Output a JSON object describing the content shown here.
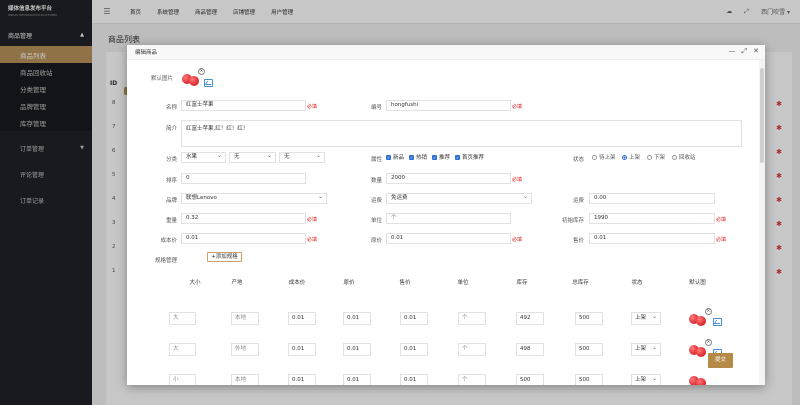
{
  "app": {
    "title": "媒体信息发布平台",
    "subtitle": "MEDIA INFORMATION PLATFORM"
  },
  "sidebar": {
    "groups": [
      {
        "label": "商品管理",
        "expanded": true,
        "items": [
          "商品列表",
          "商品回收站",
          "分类管理",
          "品牌管理",
          "库存管理"
        ],
        "active": 0
      },
      {
        "label": "订单管理",
        "expanded": false
      },
      {
        "label": "评论管理"
      },
      {
        "label": "订单记录"
      }
    ]
  },
  "topbar": {
    "nav": [
      "首页",
      "系统管理",
      "商品管理",
      "店铺管理",
      "用户管理"
    ],
    "user": "西门吹雪"
  },
  "page": {
    "title": "商品列表",
    "id_header": "ID",
    "row_ids": [
      "8",
      "7",
      "6",
      "5",
      "4",
      "3",
      "2",
      "1"
    ]
  },
  "modal": {
    "title": "编辑商品",
    "labels": {
      "default_image": "默认图片",
      "name": "名称",
      "code": "编号",
      "intro": "简介",
      "category": "分类",
      "attr": "属性",
      "status": "状态",
      "sort": "排序",
      "quantity": "数量",
      "brand": "品牌",
      "freight": "运费",
      "shipping": "运费",
      "weight": "重量",
      "unit": "单位",
      "init_stock": "初始库存",
      "cost": "成本价",
      "orig": "原价",
      "price": "售价",
      "spec": "规格管理"
    },
    "required": "必填",
    "values": {
      "name": "红富士苹果",
      "code": "hongfushi",
      "intro": "红富士苹果,红！红！红！",
      "cat1": "水果",
      "cat2": "无",
      "cat3": "无",
      "sort": "0",
      "quantity": "2000",
      "brand": "联想Lenovo",
      "freight": "免运费",
      "shipping": "0.00",
      "weight": "0.32",
      "unit": "个",
      "init_stock": "1990",
      "cost": "0.01",
      "orig": "0.01",
      "price": "0.01"
    },
    "attrs": [
      "新品",
      "热销",
      "推荐",
      "首页推荐"
    ],
    "status_options": [
      "待上架",
      "上架",
      "下架",
      "回收站"
    ],
    "status_selected": 1,
    "add_spec_button": "+添加规格",
    "spec_headers": [
      "大小",
      "产地",
      "成本价",
      "原价",
      "售价",
      "单位",
      "库存",
      "总库存",
      "状态",
      "默认图"
    ],
    "spec_rows": [
      {
        "size": "大",
        "origin": "本地",
        "cost": "0.01",
        "orig": "0.01",
        "price": "0.01",
        "unit": "个",
        "stock": "492",
        "total": "500",
        "status": "上架"
      },
      {
        "size": "大",
        "origin": "外地",
        "cost": "0.01",
        "orig": "0.01",
        "price": "0.01",
        "unit": "个",
        "stock": "498",
        "total": "500",
        "status": "上架"
      },
      {
        "size": "小",
        "origin": "本地",
        "cost": "0.01",
        "orig": "0.01",
        "price": "0.01",
        "unit": "个",
        "stock": "500",
        "total": "500",
        "status": "上架"
      }
    ],
    "submit": "提交"
  },
  "colors": {
    "accent": "#b8945a",
    "sidebar_bg": "#20222a",
    "required": "#e02020",
    "check": "#2f6fd6"
  }
}
